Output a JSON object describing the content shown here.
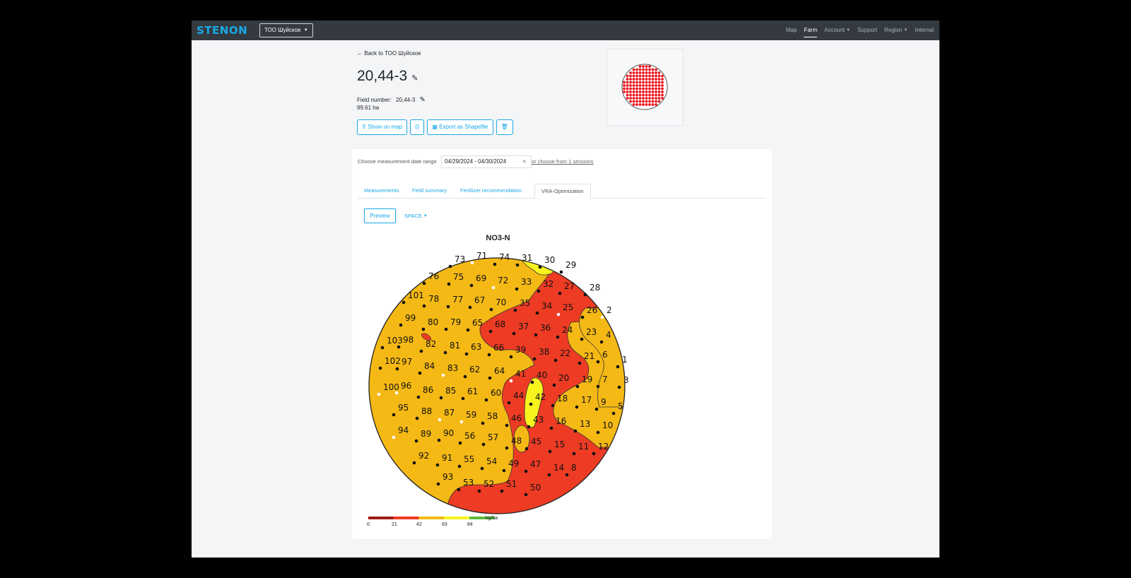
{
  "nav": {
    "brand": "STENON",
    "farm_select": "ТОО Шуйское",
    "links": [
      "Map",
      "Farm",
      "Account",
      "Support",
      "Region",
      "Internal"
    ]
  },
  "field": {
    "back_link": "Back to ТОО Шуйское",
    "title": "20,44-3",
    "field_number_label": "Field number:",
    "field_number": "20,44-3",
    "area": "99.61 ha"
  },
  "actions": {
    "show_on_map": "Show on map",
    "export": "Export as Shapefile"
  },
  "filter": {
    "date_label": "Choose measurement date range",
    "date_value": "04/29/2024 - 04/30/2024",
    "choose_sessions": "or choose from 1 sessions"
  },
  "tabs": [
    "Measurements",
    "Field summary",
    "Fertilizer recommendation",
    "VRA-Optimization"
  ],
  "vra": {
    "preview_button": "Preview",
    "space_dropdown": "SPACE"
  },
  "chart_data": {
    "type": "heatmap",
    "title": "NO3-N",
    "legend": {
      "unit": "kg/ha",
      "ticks": [
        "0",
        "21",
        "42",
        "63",
        "84"
      ],
      "colors": [
        "#9e1a12",
        "#ee3b24",
        "#f5b915",
        "#f7f41d",
        "#5cbb3b"
      ]
    },
    "sample_points": [
      "1",
      "2",
      "3",
      "4",
      "5",
      "6",
      "7",
      "8",
      "9",
      "10",
      "11",
      "12",
      "13",
      "14",
      "15",
      "16",
      "17",
      "18",
      "19",
      "20",
      "21",
      "22",
      "23",
      "24",
      "25",
      "26",
      "27",
      "28",
      "29",
      "30",
      "31",
      "32",
      "33",
      "34",
      "35",
      "36",
      "37",
      "38",
      "39",
      "40",
      "41",
      "42",
      "43",
      "44",
      "45",
      "46",
      "47",
      "48",
      "49",
      "50",
      "51",
      "52",
      "53",
      "54",
      "55",
      "56",
      "57",
      "58",
      "59",
      "60",
      "61",
      "62",
      "63",
      "64",
      "65",
      "66",
      "67",
      "68",
      "69",
      "70",
      "71",
      "72",
      "73",
      "74",
      "75",
      "76",
      "77",
      "78",
      "79",
      "80",
      "81",
      "82",
      "83",
      "84",
      "85",
      "86",
      "87",
      "88",
      "89",
      "90",
      "91",
      "92",
      "93",
      "94",
      "95",
      "96",
      "97",
      "98",
      "99",
      "100",
      "101",
      "102",
      "103"
    ]
  }
}
